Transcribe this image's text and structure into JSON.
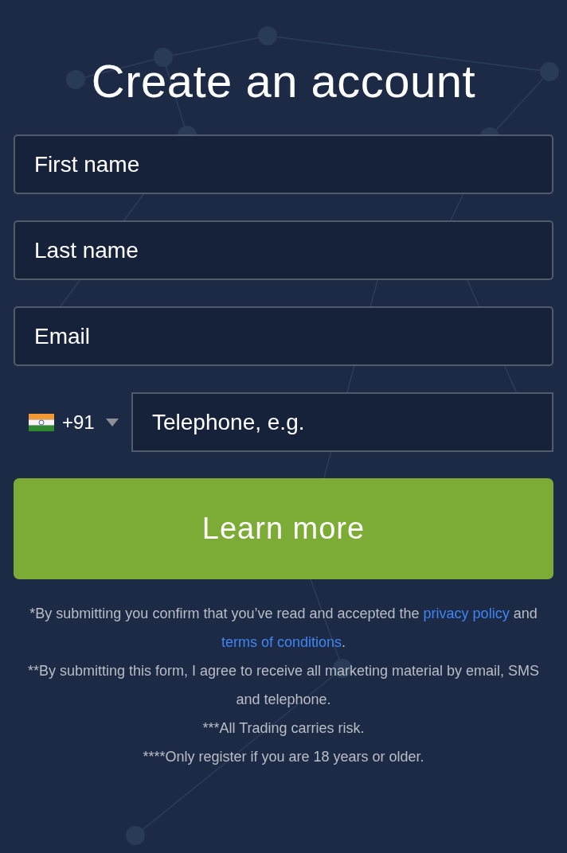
{
  "title": "Create an account",
  "fields": [
    {
      "placeholder": "First name"
    },
    {
      "placeholder": "Last name"
    },
    {
      "placeholder": "Email"
    }
  ],
  "phone": {
    "country_code": "+91",
    "placeholder": "Telephone, e.g."
  },
  "submit_button": "Learn more",
  "disclaimers": [
    {
      "parts": [
        {
          "kind": "text",
          "text": "*By submitting you confirm that you’ve read and accepted the "
        },
        {
          "kind": "link",
          "text": "privacy policy"
        },
        {
          "kind": "text",
          "text": " and "
        },
        {
          "kind": "link",
          "text": "terms of conditions"
        },
        {
          "kind": "text",
          "text": "."
        }
      ]
    },
    {
      "parts": [
        {
          "kind": "text",
          "text": "**By submitting this form, I agree to receive all marketing material by email, SMS and telephone."
        }
      ]
    },
    {
      "parts": [
        {
          "kind": "text",
          "text": "***All Trading carries risk."
        }
      ]
    },
    {
      "parts": [
        {
          "kind": "text",
          "text": "****Only register if you are 18 years or older."
        }
      ]
    }
  ]
}
